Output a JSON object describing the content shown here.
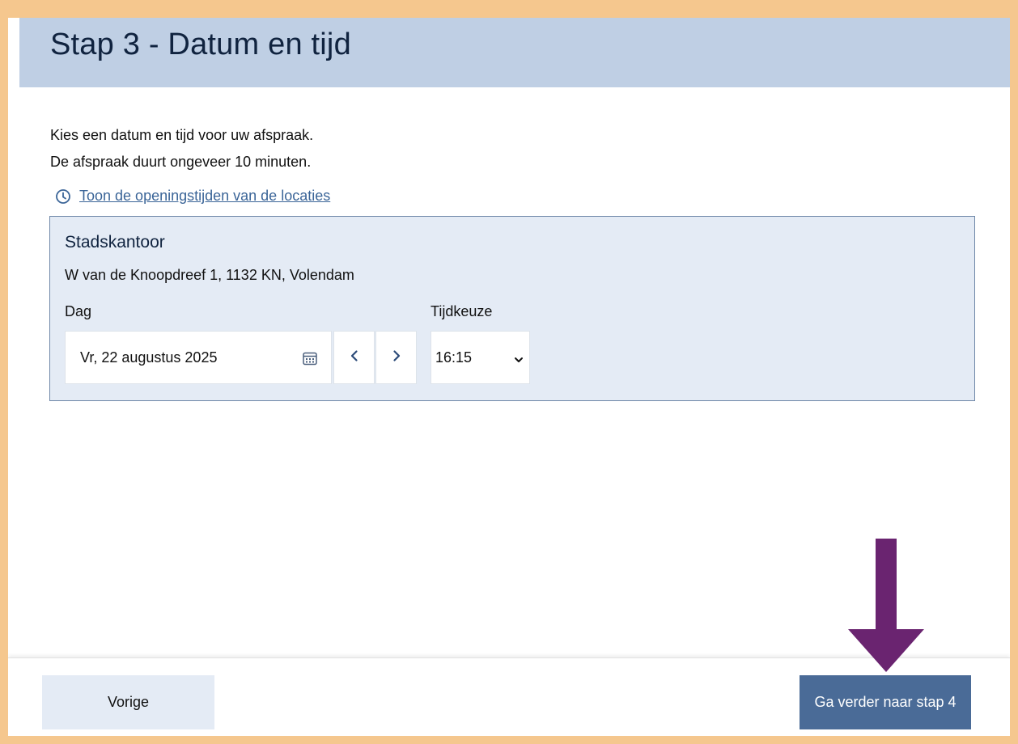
{
  "header": {
    "title": "Stap 3 - Datum en tijd"
  },
  "intro": {
    "line1": "Kies een datum en tijd voor uw afspraak.",
    "line2": "De afspraak duurt ongeveer 10 minuten."
  },
  "opening_hours_link": {
    "label": "Toon de openingstijden van de locaties",
    "icon": "clock-icon"
  },
  "location": {
    "name": "Stadskantoor",
    "address": "W van de Knoopdreef 1, 1132 KN, Volendam",
    "day_label": "Dag",
    "day_value": "Vr, 22 augustus 2025",
    "time_label": "Tijdkeuze",
    "time_value": "16:15"
  },
  "footer": {
    "prev_label": "Vorige",
    "next_label": "Ga verder naar stap 4"
  },
  "colors": {
    "page_border": "#f5c78e",
    "header_bg": "#bfcfe4",
    "card_bg": "#e4ebf5",
    "primary_button": "#4a6b97",
    "link": "#3b6598",
    "annotation_arrow": "#6a2470"
  }
}
